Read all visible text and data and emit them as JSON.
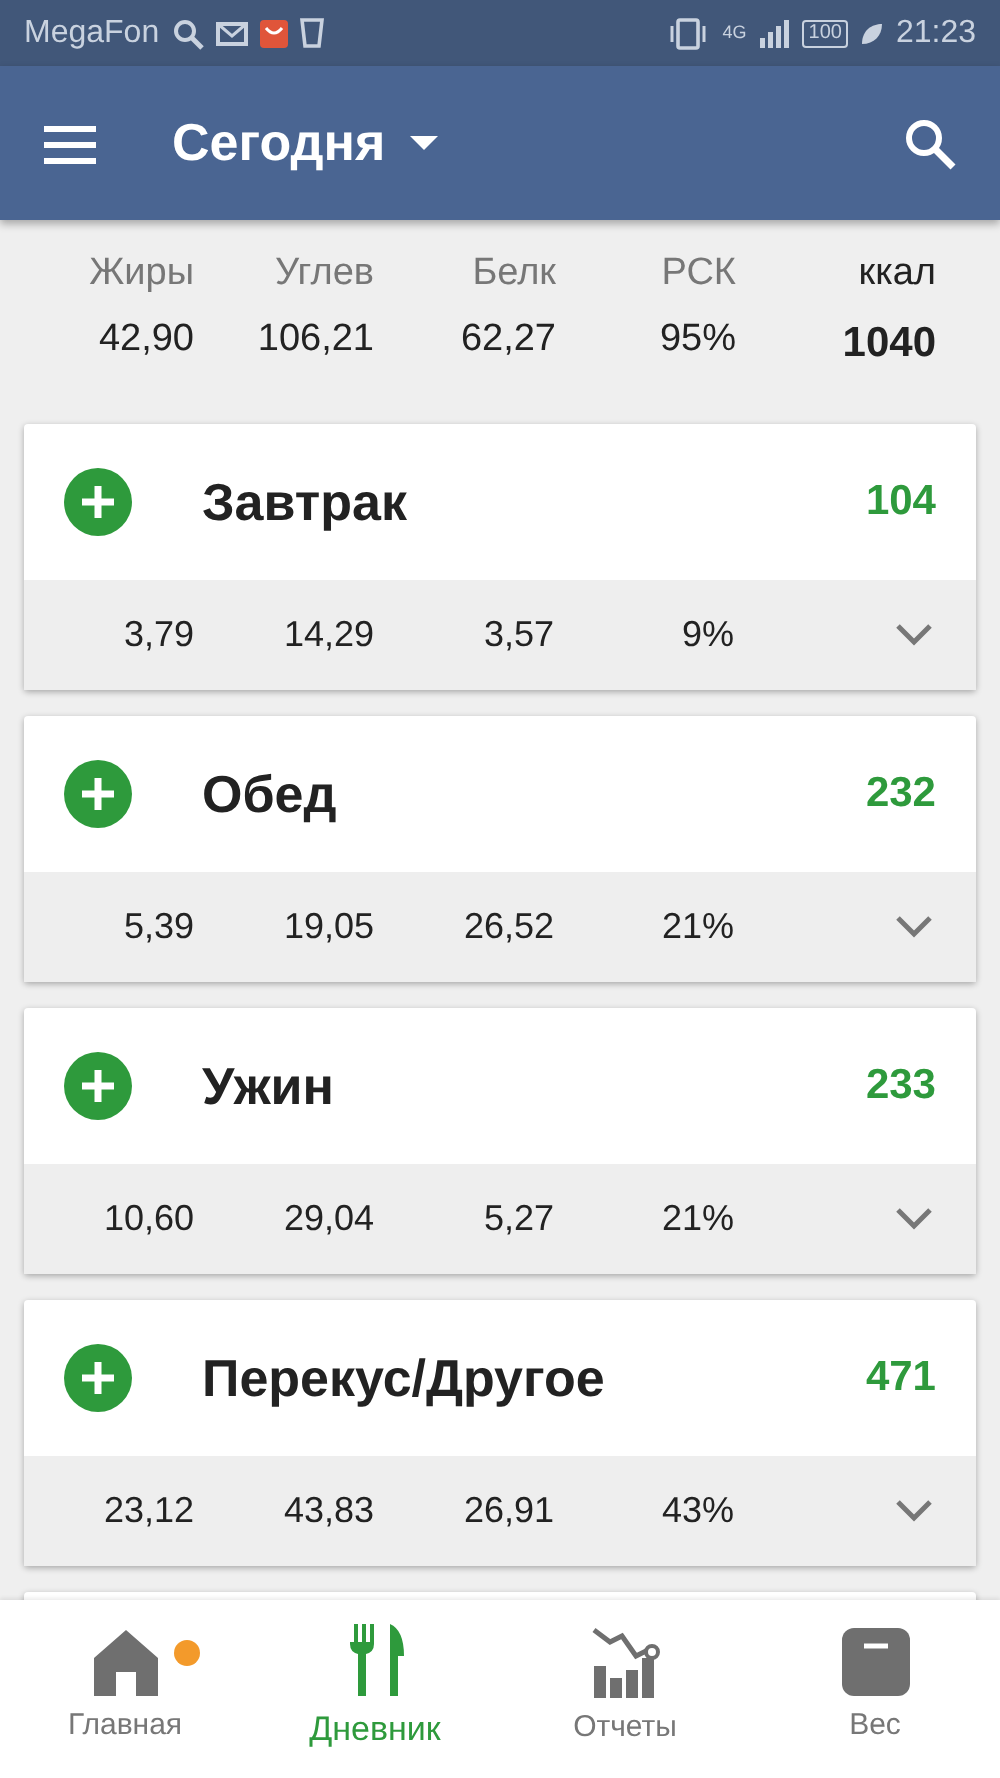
{
  "status_bar": {
    "carrier": "MegaFon",
    "network": "4G",
    "battery": "100",
    "time": "21:23"
  },
  "app_bar": {
    "title": "Сегодня"
  },
  "summary": {
    "columns": [
      {
        "label": "Жиры",
        "value": "42,90"
      },
      {
        "label": "Углев",
        "value": "106,21"
      },
      {
        "label": "Белк",
        "value": "62,27"
      },
      {
        "label": "РСК",
        "value": "95%"
      }
    ],
    "kcal_label": "ккал",
    "kcal_value": "1040"
  },
  "meals": [
    {
      "name": "Завтрак",
      "kcal": "104",
      "values": [
        "3,79",
        "14,29",
        "3,57",
        "9%"
      ],
      "expanded": false
    },
    {
      "name": "Обед",
      "kcal": "232",
      "values": [
        "5,39",
        "19,05",
        "26,52",
        "21%"
      ],
      "expanded": false
    },
    {
      "name": "Ужин",
      "kcal": "233",
      "values": [
        "10,60",
        "29,04",
        "5,27",
        "21%"
      ],
      "expanded": false
    },
    {
      "name": "Перекус/Другое",
      "kcal": "471",
      "values": [
        "23,12",
        "43,83",
        "26,91",
        "43%"
      ],
      "expanded": false
    }
  ],
  "bottom_nav": [
    {
      "label": "Главная",
      "kind": "home",
      "selected": false,
      "badge": true
    },
    {
      "label": "Дневник",
      "kind": "diary",
      "selected": true,
      "badge": false
    },
    {
      "label": "Отчеты",
      "kind": "reports",
      "selected": false,
      "badge": false
    },
    {
      "label": "Вес",
      "kind": "weight",
      "selected": false,
      "badge": false
    }
  ]
}
